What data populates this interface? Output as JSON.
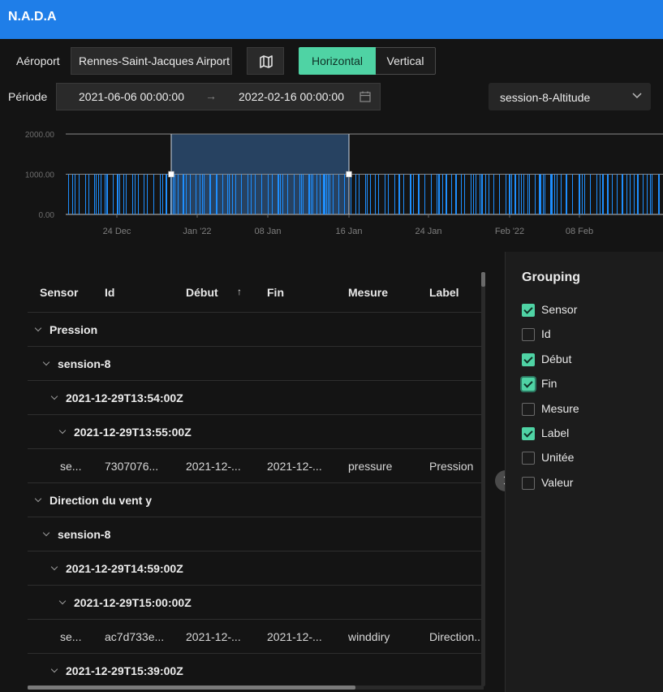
{
  "app": {
    "title": "N.A.D.A"
  },
  "controls": {
    "airport_label": "Aéroport",
    "airport_value": "Rennes-Saint-Jacques Airport",
    "map_icon": "map-icon",
    "orientation": {
      "horizontal": "Horizontal",
      "vertical": "Vertical",
      "selected": "Horizontal"
    },
    "period_label": "Période",
    "period_start": "2021-06-06 00:00:00",
    "period_arrow": "→",
    "period_end": "2022-02-16 00:00:00",
    "calendar_icon": "calendar-icon",
    "series_select": "session-8-Altitude",
    "chevron_icon": "chevron-down-icon"
  },
  "chart_data": {
    "type": "bar",
    "ylabels": [
      "2000.00",
      "1000.00",
      "0.00"
    ],
    "yticks": [
      2000,
      1000,
      0
    ],
    "ylim": [
      0,
      2000
    ],
    "xlabels": [
      "24 Dec",
      "Jan '22",
      "08 Jan",
      "16 Jan",
      "24 Jan",
      "Feb '22",
      "08 Feb"
    ],
    "bar_value": 1000,
    "colors": {
      "bar": "#1e8fff",
      "brush": "#2a4a6e",
      "axis": "#7a7a7a"
    }
  },
  "table": {
    "columns": [
      "Sensor",
      "Id",
      "Début",
      "Fin",
      "Mesure",
      "Label"
    ],
    "sort_indicator": "↑",
    "rows": [
      {
        "level": 0,
        "text": "Pression"
      },
      {
        "level": 1,
        "text": "sension-8"
      },
      {
        "level": 2,
        "text": "2021-12-29T13:54:00Z"
      },
      {
        "level": 3,
        "text": "2021-12-29T13:55:00Z"
      },
      {
        "cells": [
          "se...",
          "7307076...",
          "2021-12-...",
          "2021-12-...",
          "pressure",
          "Pression"
        ]
      },
      {
        "level": 0,
        "text": "Direction du vent y"
      },
      {
        "level": 1,
        "text": "sension-8"
      },
      {
        "level": 2,
        "text": "2021-12-29T14:59:00Z"
      },
      {
        "level": 3,
        "text": "2021-12-29T15:00:00Z"
      },
      {
        "cells": [
          "se...",
          "ac7d733e...",
          "2021-12-...",
          "2021-12-...",
          "winddiry",
          "Direction..."
        ]
      },
      {
        "level": 2,
        "text": "2021-12-29T15:39:00Z"
      }
    ]
  },
  "grouping": {
    "title": "Grouping",
    "options": [
      {
        "label": "Sensor",
        "checked": true
      },
      {
        "label": "Id",
        "checked": false
      },
      {
        "label": "Début",
        "checked": true
      },
      {
        "label": "Fin",
        "checked": true
      },
      {
        "label": "Mesure",
        "checked": false
      },
      {
        "label": "Label",
        "checked": true
      },
      {
        "label": "Unitée",
        "checked": false
      },
      {
        "label": "Valeur",
        "checked": false
      }
    ]
  },
  "panel_toggle_icon": "chevron-right-icon"
}
